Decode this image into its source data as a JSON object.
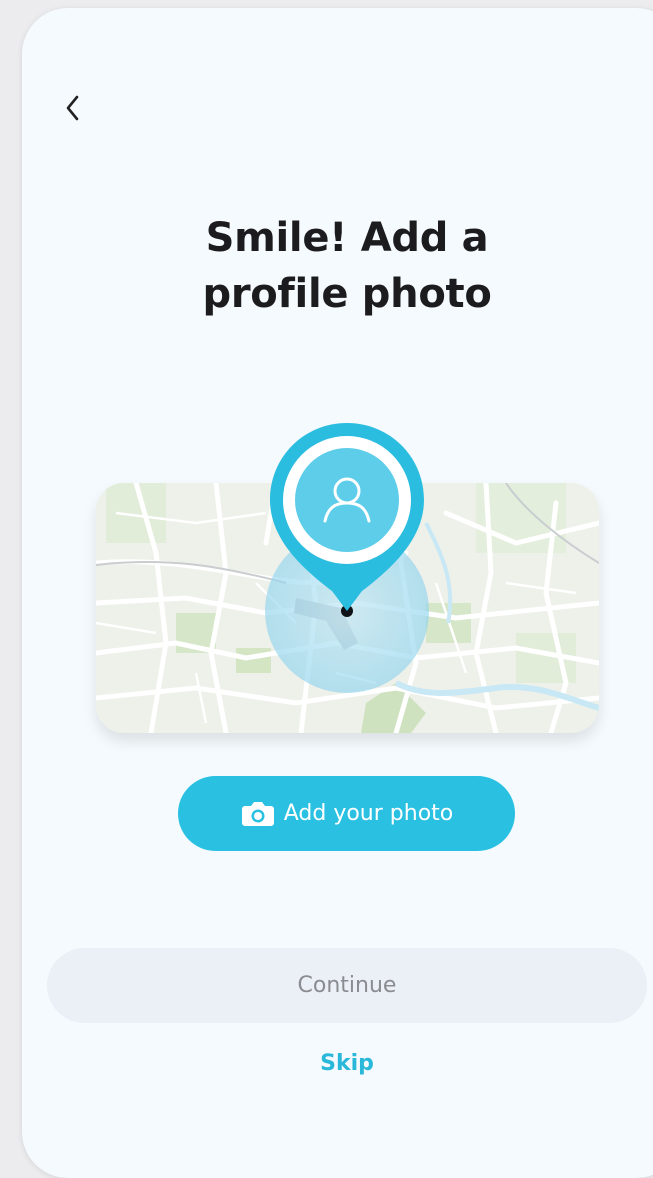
{
  "header": {
    "back_icon": "chevron-left-icon"
  },
  "title": {
    "line1": "Smile! Add a",
    "line2": "profile photo"
  },
  "illustration": {
    "map": "map-illustration",
    "pin_icon": "user-icon"
  },
  "buttons": {
    "add_photo_label": "Add your photo",
    "add_photo_icon": "camera-icon",
    "continue_label": "Continue",
    "skip_label": "Skip"
  },
  "colors": {
    "accent": "#29c0e2",
    "background": "#f4fafd",
    "continue_bg": "#ebeff6",
    "continue_text": "#8a8c90",
    "title": "#1c1c1e"
  }
}
